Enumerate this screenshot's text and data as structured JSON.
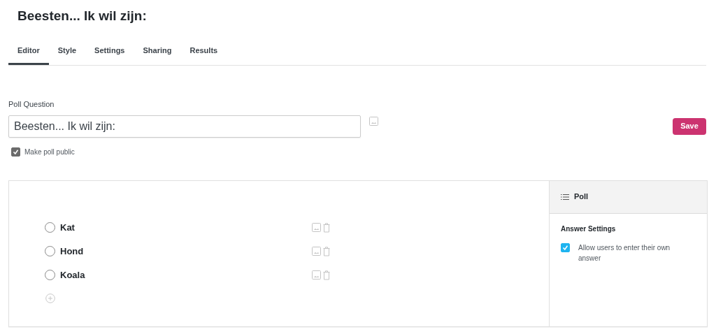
{
  "title": "Beesten... Ik wil zijn:",
  "tabs": [
    {
      "label": "Editor",
      "selected": true
    },
    {
      "label": "Style",
      "selected": false
    },
    {
      "label": "Settings",
      "selected": false
    },
    {
      "label": "Sharing",
      "selected": false
    },
    {
      "label": "Results",
      "selected": false
    }
  ],
  "question": {
    "label": "Poll Question",
    "value": "Beesten... Ik wil zijn:"
  },
  "save_button": "Save",
  "public": {
    "label": "Make poll public",
    "checked": true
  },
  "answers": [
    {
      "label": "Kat",
      "selected": false
    },
    {
      "label": "Hond",
      "selected": false
    },
    {
      "label": "Koala",
      "selected": false
    }
  ],
  "sidebar": {
    "title": "Poll",
    "section": "Answer Settings",
    "option": {
      "label": "Allow users to enter their own answer",
      "checked": true
    }
  }
}
